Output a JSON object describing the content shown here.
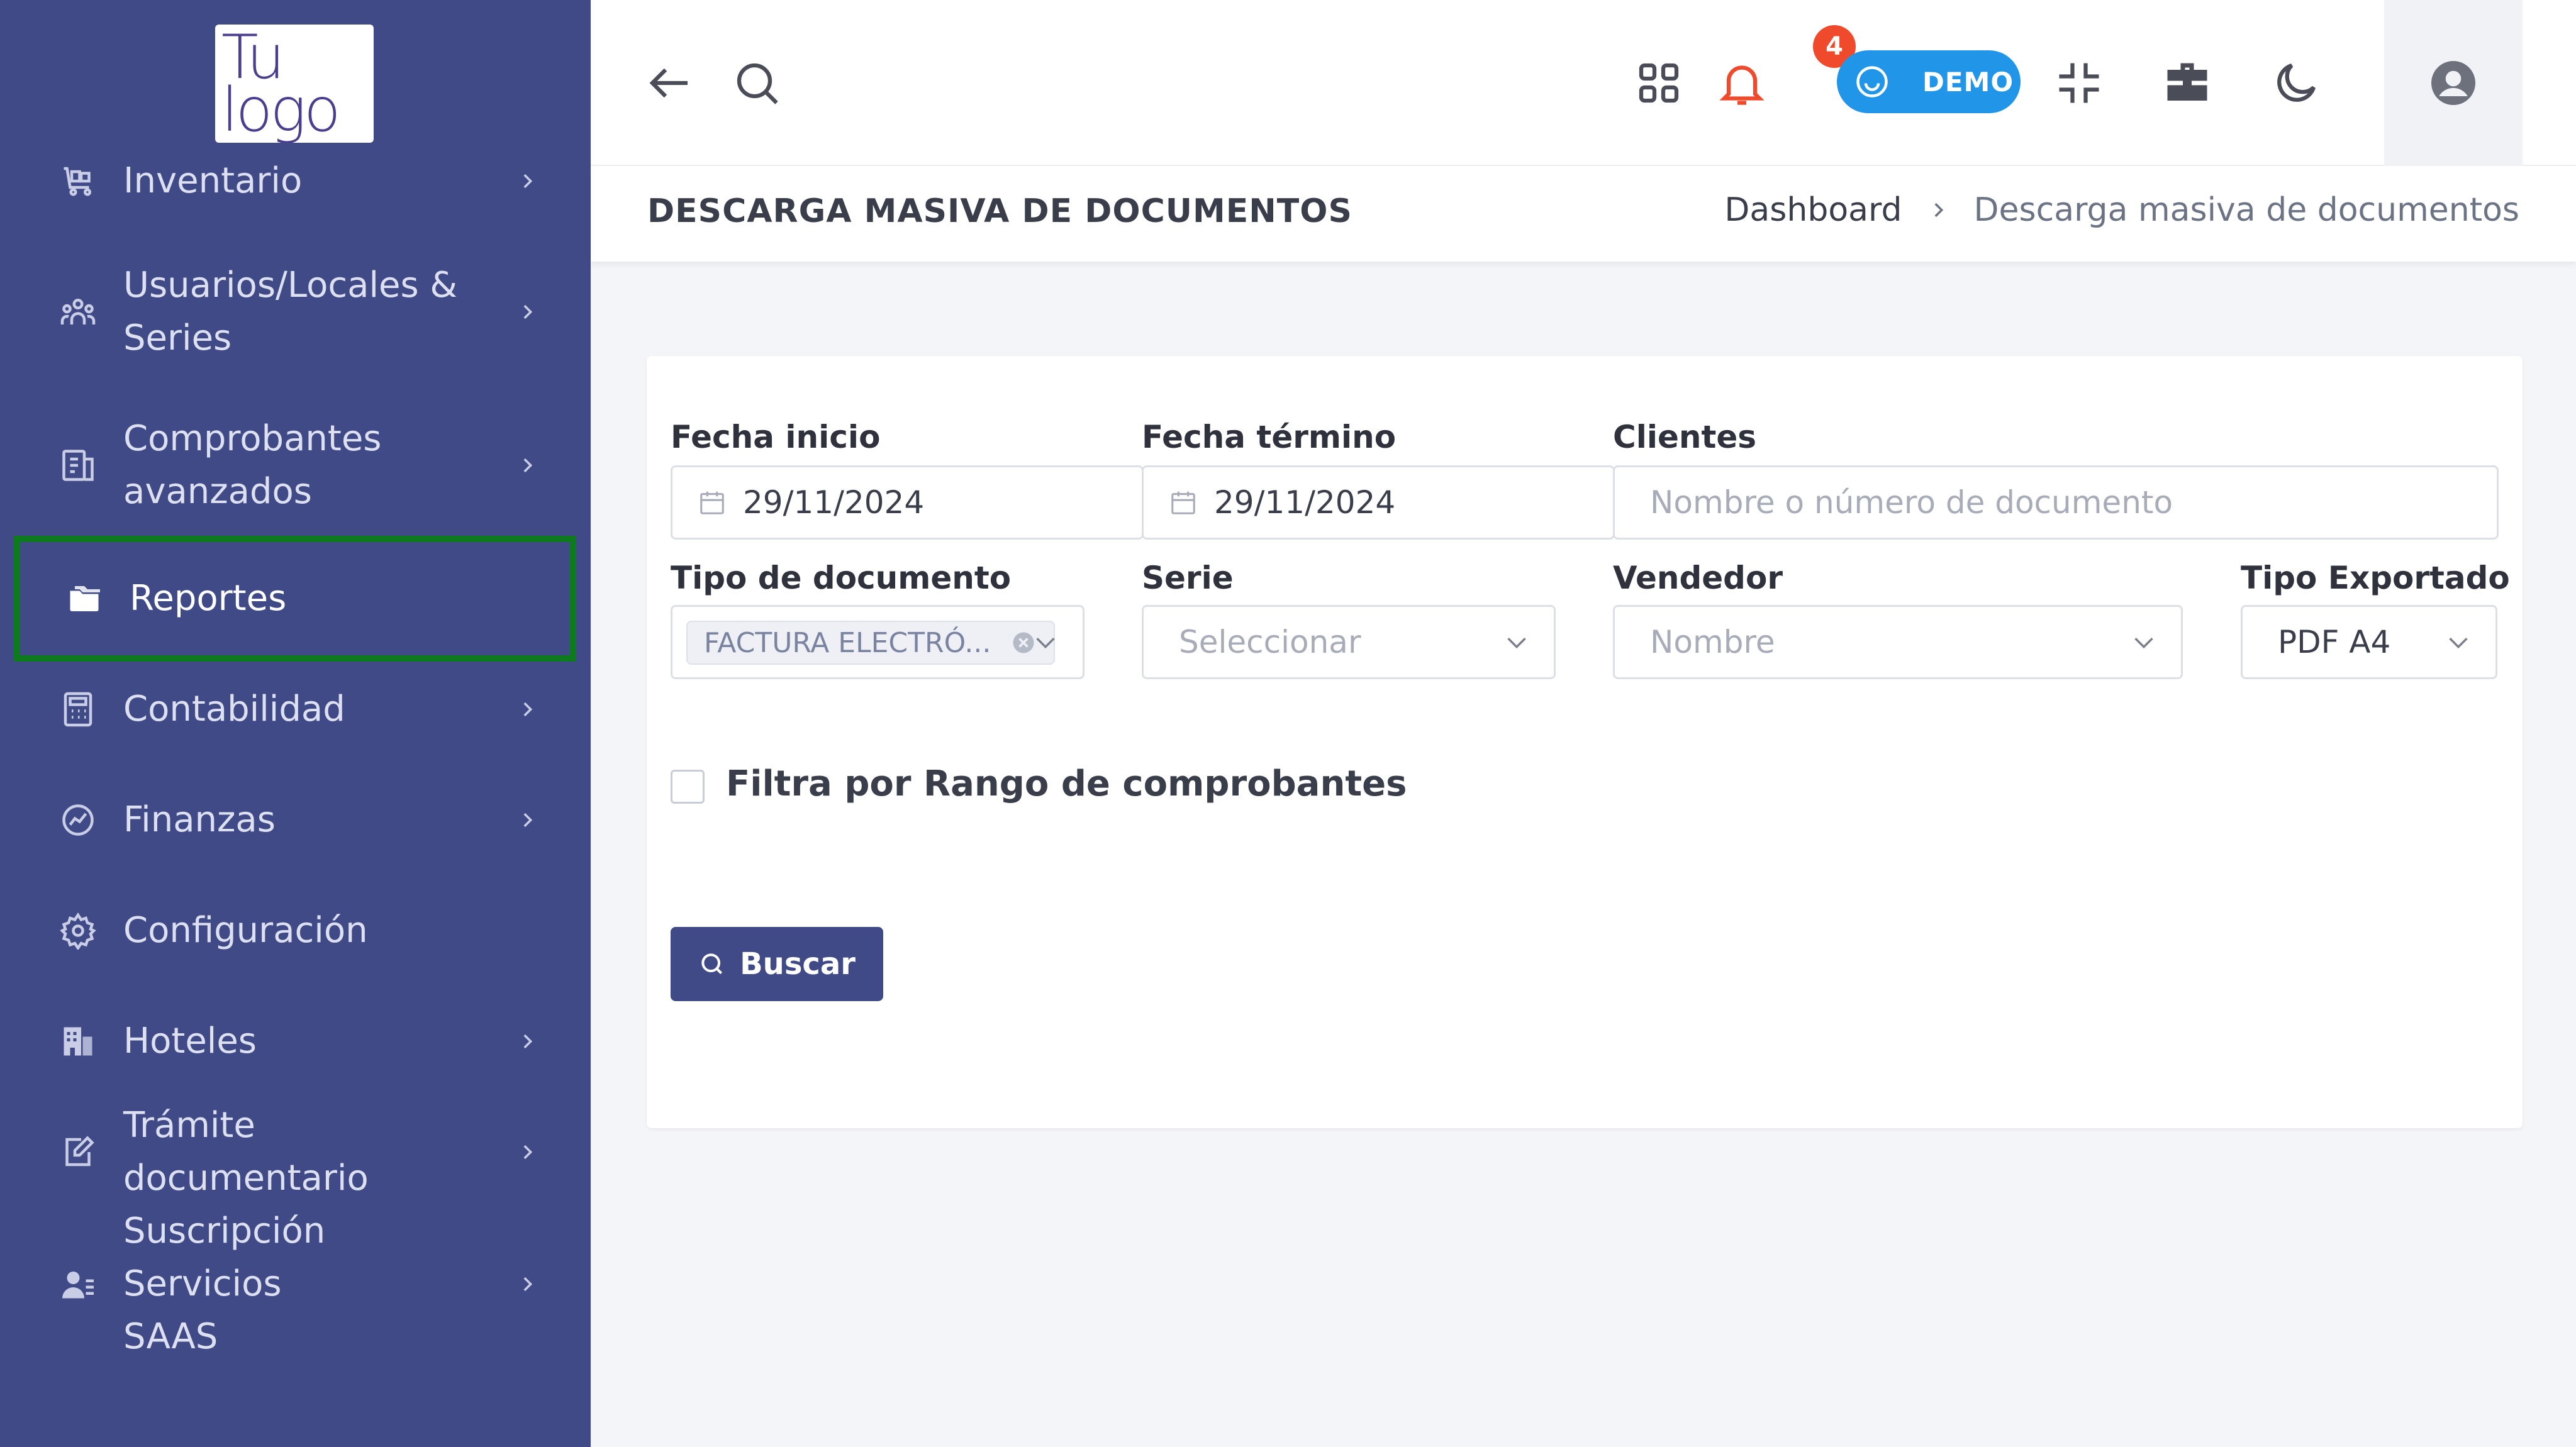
{
  "logo": {
    "line1": "Tu",
    "line2": "logo"
  },
  "sidebar": {
    "items": [
      {
        "label": "Inventario"
      },
      {
        "label": "Usuarios/Locales &\nSeries"
      },
      {
        "label": "Comprobantes\navanzados"
      },
      {
        "label": "Reportes"
      },
      {
        "label": "Contabilidad"
      },
      {
        "label": "Finanzas"
      },
      {
        "label": "Configuración"
      },
      {
        "label": "Hoteles"
      },
      {
        "label": "Trámite documentario"
      },
      {
        "label": "Suscripción Servicios\nSAAS"
      }
    ]
  },
  "topbar": {
    "notification_count": "4",
    "demo_label": "DEMO"
  },
  "page": {
    "title": "DESCARGA MASIVA DE DOCUMENTOS",
    "breadcrumb": {
      "home": "Dashboard",
      "current": "Descarga masiva de documentos"
    }
  },
  "form": {
    "fecha_inicio": {
      "label": "Fecha inicio",
      "value": "29/11/2024"
    },
    "fecha_termino": {
      "label": "Fecha término",
      "value": "29/11/2024"
    },
    "clientes": {
      "label": "Clientes",
      "placeholder": "Nombre o número de documento"
    },
    "tipo_documento": {
      "label": "Tipo de documento",
      "selected_tag": "FACTURA ELECTRÓ..."
    },
    "serie": {
      "label": "Serie",
      "placeholder": "Seleccionar"
    },
    "vendedor": {
      "label": "Vendedor",
      "placeholder": "Nombre"
    },
    "tipo_exportado": {
      "label": "Tipo Exportado",
      "value": "PDF A4"
    },
    "rango_checkbox": {
      "label": "Filtra por Rango de comprobantes",
      "checked": false
    },
    "search_button": {
      "label": "Buscar"
    }
  },
  "colors": {
    "sidebar": "#3f4a87",
    "active_outline": "#0e7a1e",
    "demo_pill": "#2196e8",
    "badge": "#ef4a2c",
    "primary_button": "#3f4a87"
  }
}
